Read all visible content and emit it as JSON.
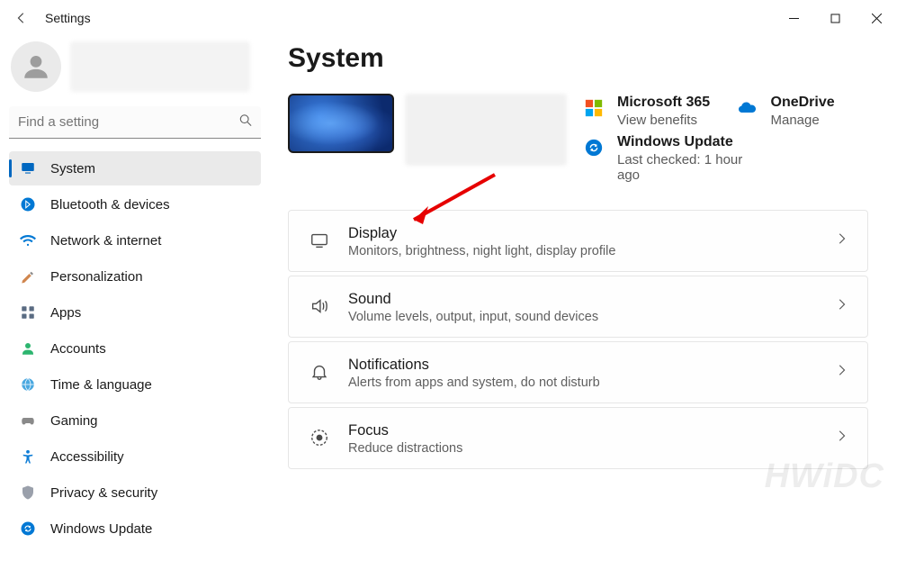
{
  "app": {
    "title": "Settings"
  },
  "search": {
    "placeholder": "Find a setting"
  },
  "nav": {
    "items": [
      {
        "label": "System",
        "icon": "monitor-icon",
        "selected": true
      },
      {
        "label": "Bluetooth & devices",
        "icon": "bluetooth-icon"
      },
      {
        "label": "Network & internet",
        "icon": "wifi-icon"
      },
      {
        "label": "Personalization",
        "icon": "paintbrush-icon"
      },
      {
        "label": "Apps",
        "icon": "apps-icon"
      },
      {
        "label": "Accounts",
        "icon": "person-icon"
      },
      {
        "label": "Time & language",
        "icon": "globe-clock-icon"
      },
      {
        "label": "Gaming",
        "icon": "gamepad-icon"
      },
      {
        "label": "Accessibility",
        "icon": "accessibility-icon"
      },
      {
        "label": "Privacy & security",
        "icon": "shield-icon"
      },
      {
        "label": "Windows Update",
        "icon": "update-icon"
      }
    ]
  },
  "page": {
    "title": "System"
  },
  "hero_tiles": {
    "m365": {
      "title": "Microsoft 365",
      "sub": "View benefits"
    },
    "onedrive": {
      "title": "OneDrive",
      "sub": "Manage"
    },
    "update": {
      "title": "Windows Update",
      "sub": "Last checked: 1 hour ago"
    }
  },
  "settings": [
    {
      "key": "display",
      "title": "Display",
      "desc": "Monitors, brightness, night light, display profile",
      "icon": "display-icon"
    },
    {
      "key": "sound",
      "title": "Sound",
      "desc": "Volume levels, output, input, sound devices",
      "icon": "speaker-icon"
    },
    {
      "key": "notifications",
      "title": "Notifications",
      "desc": "Alerts from apps and system, do not disturb",
      "icon": "bell-icon"
    },
    {
      "key": "focus",
      "title": "Focus",
      "desc": "Reduce distractions",
      "icon": "focus-icon"
    }
  ],
  "watermark": "HWiDC"
}
